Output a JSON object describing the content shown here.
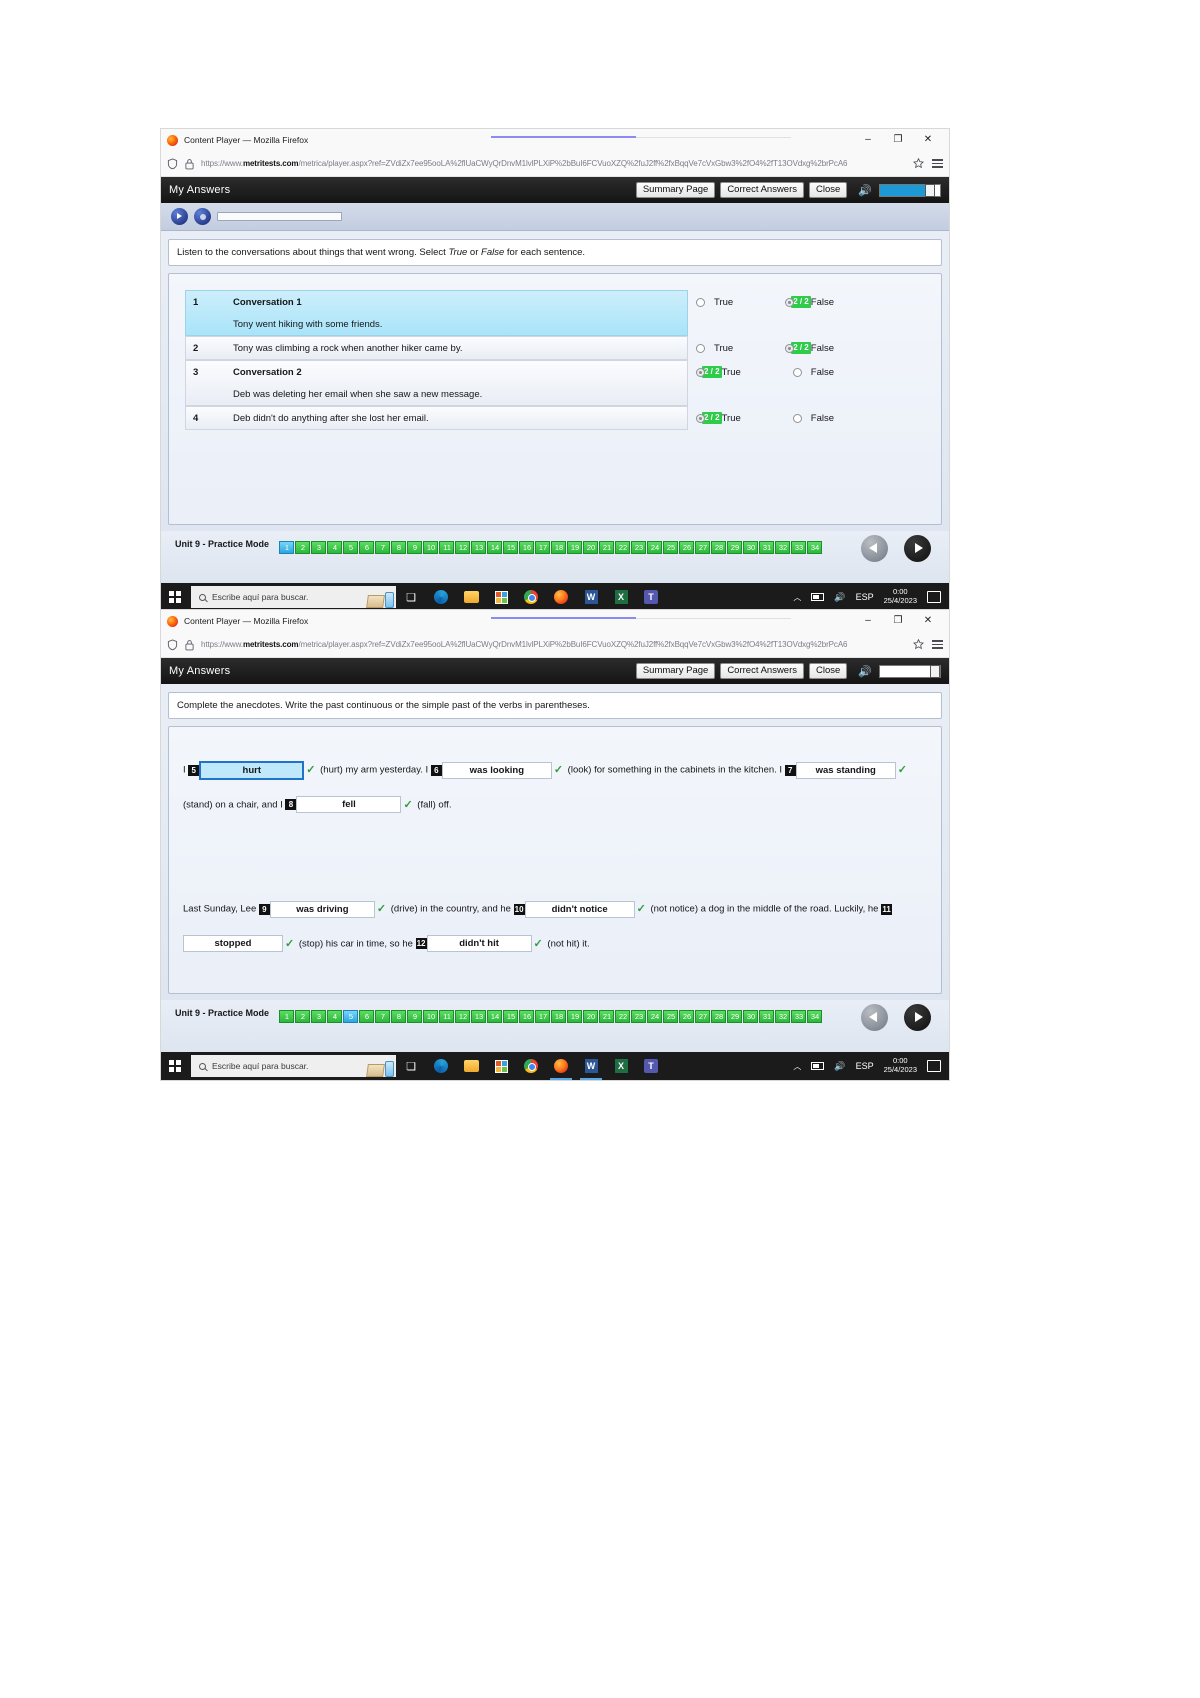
{
  "browser": {
    "title": "Content Player — Mozilla Firefox",
    "url_scheme": "https://www.",
    "url_domain": "metritests.com",
    "url_path": "/metrica/player.aspx?ref=ZVdiZx7ee95ooLA%2flUaCWyQrDnvM1lvlPLXiP%2bBuI6FCVuoXZQ%2fuJ2ff%2fxBqqVe7cVxGbw3%2fO4%2fT13OVdxg%2brPcA6",
    "minimize": "–",
    "maximize": "❐",
    "close": "✕"
  },
  "app": {
    "title": "My Answers",
    "summary_button": "Summary Page",
    "correct_answers_button": "Correct Answers",
    "close_button": "Close",
    "speaker_icon": "🔊"
  },
  "window1": {
    "instructions_pre": "Listen to the conversations about things that went wrong. Select ",
    "instructions_true": "True",
    "instructions_mid": " or ",
    "instructions_false": "False",
    "instructions_post": " for each sentence.",
    "questions": [
      {
        "number": "1",
        "heading": "Conversation 1",
        "sentence": "Tony went hiking with some friends.",
        "highlighted": true,
        "true_label": "True",
        "false_label": "False",
        "selected": "False",
        "score": "2 / 2"
      },
      {
        "number": "2",
        "heading": "",
        "sentence": "Tony was climbing a rock when another hiker came by.",
        "highlighted": false,
        "true_label": "True",
        "false_label": "False",
        "selected": "False",
        "score": "2 / 2"
      },
      {
        "number": "3",
        "heading": "Conversation 2",
        "sentence": "Deb was deleting her email when she saw a new message.",
        "highlighted": false,
        "true_label": "True",
        "false_label": "False",
        "selected": "True",
        "score": "2 / 2"
      },
      {
        "number": "4",
        "heading": "",
        "sentence": "Deb didn't do anything after she lost her email.",
        "highlighted": false,
        "true_label": "True",
        "false_label": "False",
        "selected": "True",
        "score": "2 / 2"
      }
    ],
    "player": {
      "play_icon": "play-icon",
      "stop_icon": "stop-icon"
    },
    "volume_percent": 78
  },
  "window2": {
    "instructions": "Complete the anecdotes. Write the past continuous or the simple past of the verbs in parentheses.",
    "volume_percent": 100,
    "paragraph1": [
      {
        "type": "text",
        "value": "I "
      },
      {
        "type": "blank",
        "number": "5",
        "value": "hurt",
        "focused": true,
        "correct": true
      },
      {
        "type": "text",
        "value": "(hurt) my arm yesterday. I "
      },
      {
        "type": "blank",
        "number": "6",
        "value": "was looking",
        "focused": false,
        "correct": true
      },
      {
        "type": "text",
        "value": "(look) for something in the cabinets in the kitchen. I "
      },
      {
        "type": "blank",
        "number": "7",
        "value": "was standing",
        "focused": false,
        "correct": true
      },
      {
        "type": "text",
        "value": "(stand) on a chair, and I "
      },
      {
        "type": "blank",
        "number": "8",
        "value": "fell",
        "focused": false,
        "correct": true
      },
      {
        "type": "text",
        "value": "(fall) off."
      }
    ],
    "paragraph2": [
      {
        "type": "text",
        "value": "Last Sunday, Lee "
      },
      {
        "type": "blank",
        "number": "9",
        "value": "was driving",
        "focused": false,
        "correct": true
      },
      {
        "type": "text",
        "value": "(drive) in the country, and he "
      },
      {
        "type": "blank",
        "number": "10",
        "value": "didn't notice",
        "focused": false,
        "correct": true
      },
      {
        "type": "text",
        "value": "(not notice) a dog in the middle of the road. Luckily, he "
      },
      {
        "type": "blank",
        "number": "11",
        "value": "stopped",
        "focused": false,
        "correct": true
      },
      {
        "type": "text",
        "value": "(stop) his car in time, so he "
      },
      {
        "type": "blank",
        "number": "12",
        "value": "didn't hit",
        "focused": false,
        "correct": true
      },
      {
        "type": "text",
        "value": "(not hit) it."
      }
    ]
  },
  "footer": {
    "unit_label": "Unit 9 - Practice Mode",
    "pages": [
      "1",
      "2",
      "3",
      "4",
      "5",
      "6",
      "7",
      "8",
      "9",
      "10",
      "11",
      "12",
      "13",
      "14",
      "15",
      "16",
      "17",
      "18",
      "19",
      "20",
      "21",
      "22",
      "23",
      "24",
      "25",
      "26",
      "27",
      "28",
      "29",
      "30",
      "31",
      "32",
      "33",
      "34"
    ],
    "current_page_window1": "1",
    "current_page_window2": "5",
    "prev_label": "prev-arrow",
    "next_label": "next-arrow"
  },
  "taskbar": {
    "search_placeholder": "Escribe aquí para buscar.",
    "language": "ESP",
    "clock_time": "0:00",
    "clock_date": "25/4/2023",
    "apps": [
      "task-view",
      "edge",
      "file-explorer",
      "microsoft-store",
      "chrome",
      "firefox",
      "word",
      "excel",
      "teams"
    ]
  },
  "colors": {
    "score_green": "#2ecc4a",
    "highlight_blue": "#a9e4f9",
    "focus_border": "#1f73c9",
    "tick_green": "#2f9e3f",
    "page_green": "#2cb83a",
    "page_current": "#2aa6e0"
  }
}
